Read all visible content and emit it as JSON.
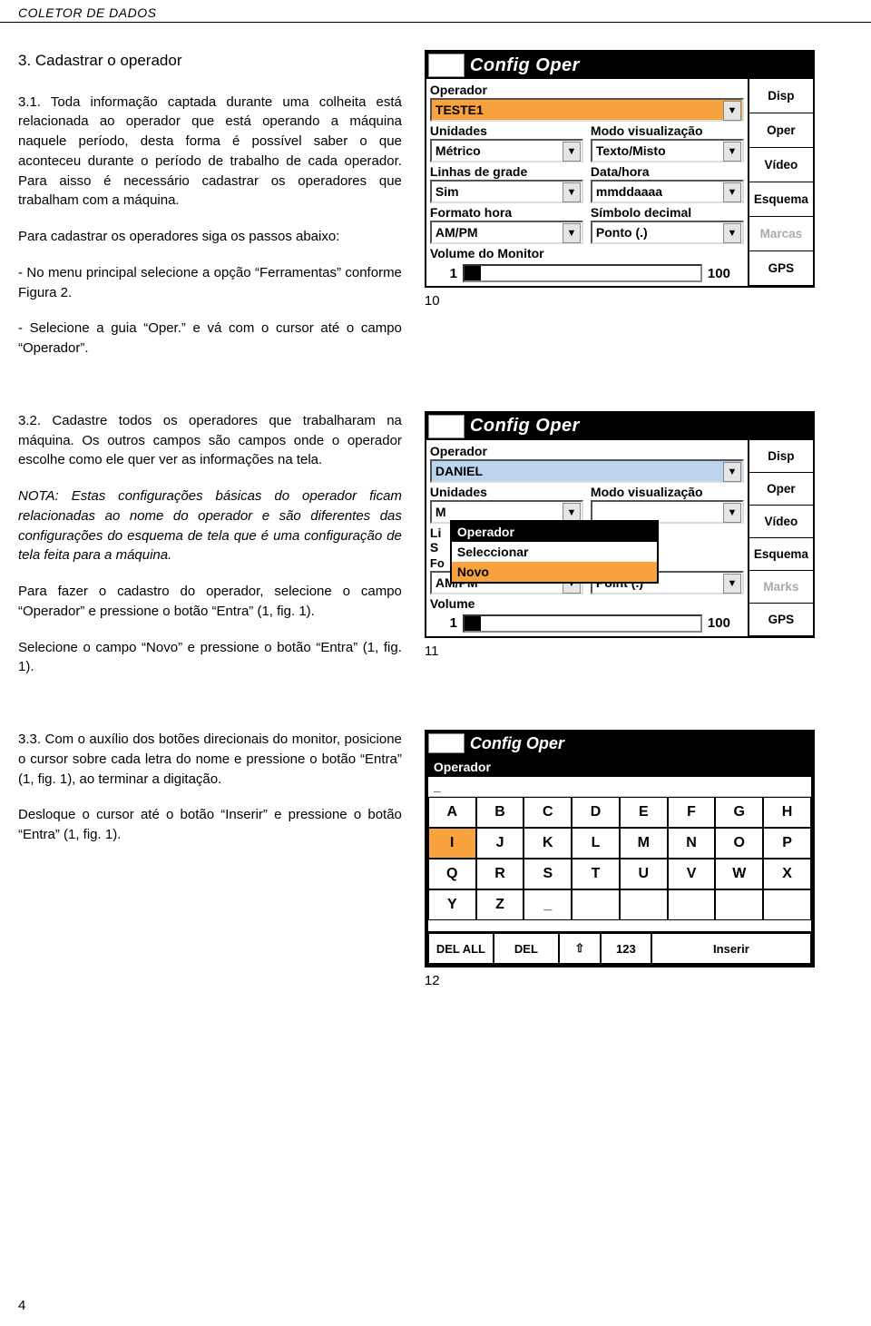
{
  "header": {
    "title": "COLETOR DE DADOS"
  },
  "page_number": "4",
  "s1": {
    "heading": "3. Cadastrar o operador",
    "p1": "3.1. Toda informação captada durante uma colheita está relacionada ao operador que está operando a máquina naquele período, desta forma é possível saber o que aconteceu durante o período de trabalho de cada operador. Para aisso é necessário cadastrar os operadores que trabalham com a máquina.",
    "p2": "Para cadastrar os operadores siga os passos abaixo:",
    "p3": "- No menu principal selecione a opção “Ferramentas” conforme Figura 2.",
    "p4": "- Selecione a guia “Oper.” e vá com o cursor até o campo “Operador”.",
    "fig": "10"
  },
  "s2": {
    "p1": "3.2. Cadastre todos os operadores que trabalharam na máquina. Os outros campos são campos onde o operador escolhe como ele quer ver as informações na tela.",
    "p2": "NOTA: Estas configurações básicas do operador ficam relacionadas ao nome do operador e são diferentes das configurações do esquema de tela que é uma configuração de tela feita para a máquina.",
    "p3": "Para fazer o cadastro do operador, selecione o campo “Operador” e pressione o botão “Entra” (1, fig. 1).",
    "p4": "Selecione o campo “Novo” e pressione o botão “Entra” (1, fig. 1).",
    "fig": "11"
  },
  "s3": {
    "p1": "3.3. Com o auxílio dos botões direcionais do monitor, posicione o cursor sobre cada letra do nome e pressione o botão “Entra” (1, fig. 1), ao terminar a digitação.",
    "p2": "Desloque o cursor até o botão “Inserir” e pressione o botão “Entra” (1, fig. 1).",
    "fig": "12"
  },
  "dev1": {
    "title": "Config Oper",
    "labels": {
      "operador": "Operador",
      "unidades": "Unidades",
      "modo": "Modo visualização",
      "linhas": "Linhas de grade",
      "data": "Data/hora",
      "formato": "Formato hora",
      "simbolo": "Símbolo decimal",
      "volume": "Volume do Monitor"
    },
    "values": {
      "operador": "TESTE1",
      "unidades": "Métrico",
      "modo": "Texto/Misto",
      "linhas": "Sim",
      "data": "mmddaaaa",
      "formato": "AM/PM",
      "simbolo": "Ponto (.)",
      "vol_min": "1",
      "vol_max": "100"
    },
    "side": [
      "Disp",
      "Oper",
      "Vídeo",
      "Esquema",
      "Marcas",
      "GPS"
    ]
  },
  "dev2": {
    "title": "Config Oper",
    "labels": {
      "operador": "Operador",
      "unidades": "Unidades",
      "modo": "Modo visualização",
      "volume": "Volume"
    },
    "values": {
      "operador": "DANIEL",
      "formato": "AM/PM",
      "simbolo": "Point (.)",
      "vol_min": "1",
      "vol_max": "100"
    },
    "side": [
      "Disp",
      "Oper",
      "Vídeo",
      "Esquema",
      "Marks",
      "GPS"
    ],
    "popup": {
      "title": "Operador",
      "items": [
        "Seleccionar",
        "Novo"
      ]
    },
    "stub": {
      "m": "M",
      "l": "Li",
      "s": "S",
      "f": "Fo"
    }
  },
  "dev3": {
    "title": "Config Oper",
    "panel_title": "Operador",
    "cursor": "_",
    "keys_row1": [
      "A",
      "B",
      "C",
      "D",
      "E",
      "F",
      "G",
      "H"
    ],
    "keys_row2": [
      "I",
      "J",
      "K",
      "L",
      "M",
      "N",
      "O",
      "P"
    ],
    "keys_row3": [
      "Q",
      "R",
      "S",
      "T",
      "U",
      "V",
      "W",
      "X"
    ],
    "keys_row4": [
      "Y",
      "Z",
      "_"
    ],
    "bottom": {
      "delall": "DEL ALL",
      "del": "DEL",
      "shift": "⇧",
      "num": "123",
      "inserir": "Inserir"
    }
  }
}
